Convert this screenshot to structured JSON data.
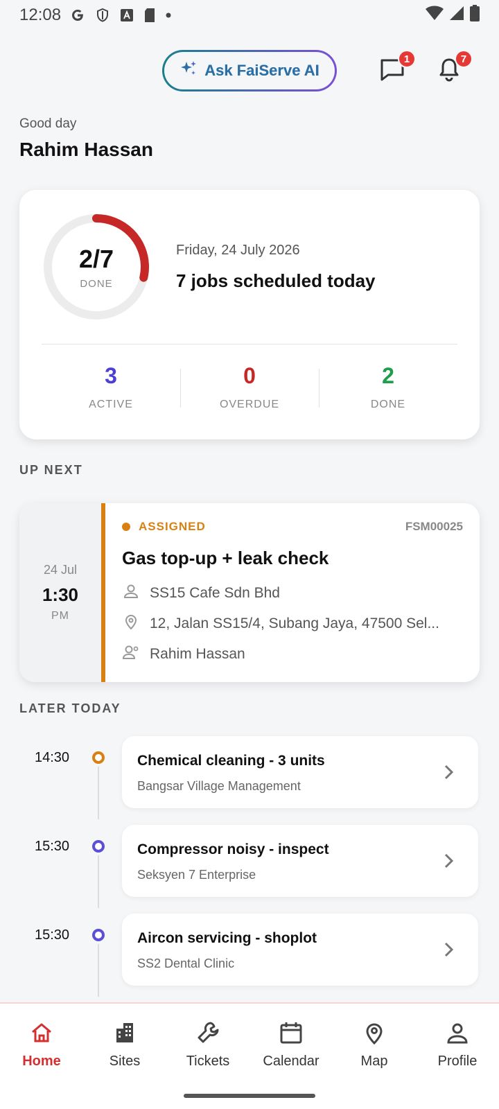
{
  "status_bar": {
    "time": "12:08"
  },
  "header": {
    "ask_ai_label": "Ask FaiServe AI",
    "messages_badge": "1",
    "notifications_badge": "7"
  },
  "greeting": {
    "salutation": "Good day",
    "name": "Rahim Hassan"
  },
  "summary": {
    "done_count": "2/7",
    "done_label": "DONE",
    "progress_fraction": 0.2857,
    "date": "Friday, 24 July 2026",
    "jobs_text": "7 jobs scheduled today",
    "stats": [
      {
        "value": "3",
        "label": "ACTIVE",
        "color": "#4b3fd6"
      },
      {
        "value": "0",
        "label": "OVERDUE",
        "color": "#c62828"
      },
      {
        "value": "2",
        "label": "DONE",
        "color": "#1e9e4a"
      }
    ],
    "ring_color": "#c62828",
    "ring_track_color": "#ececec"
  },
  "up_next": {
    "section_title": "UP NEXT",
    "date": "24 Jul",
    "time": "1:30",
    "ampm": "PM",
    "status": "ASSIGNED",
    "status_color": "#d98012",
    "job_id": "FSM00025",
    "title": "Gas top-up + leak check",
    "customer": "SS15 Cafe Sdn Bhd",
    "address": "12, Jalan SS15/4, Subang Jaya, 47500 Sel...",
    "technician": "Rahim Hassan"
  },
  "later_today": {
    "section_title": "LATER TODAY",
    "items": [
      {
        "time": "14:30",
        "title": "Chemical cleaning - 3 units",
        "subtitle": "Bangsar Village Management",
        "dot_color": "#d98012"
      },
      {
        "time": "15:30",
        "title": "Compressor noisy - inspect",
        "subtitle": "Seksyen 7 Enterprise",
        "dot_color": "#5b4fd6"
      },
      {
        "time": "15:30",
        "title": "Aircon servicing - shoplot",
        "subtitle": "SS2 Dental Clinic",
        "dot_color": "#5b4fd6"
      }
    ]
  },
  "bottom_nav": {
    "items": [
      {
        "label": "Home",
        "icon": "home-icon",
        "active": true
      },
      {
        "label": "Sites",
        "icon": "building-icon",
        "active": false
      },
      {
        "label": "Tickets",
        "icon": "wrench-icon",
        "active": false
      },
      {
        "label": "Calendar",
        "icon": "calendar-icon",
        "active": false
      },
      {
        "label": "Map",
        "icon": "map-pin-icon",
        "active": false
      },
      {
        "label": "Profile",
        "icon": "person-icon",
        "active": false
      }
    ]
  }
}
